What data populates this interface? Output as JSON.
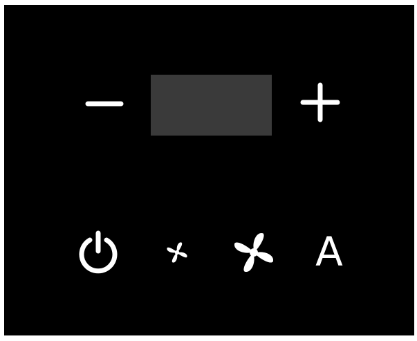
{
  "panel": {
    "background_color": "#000000",
    "foreground_color": "#ffffff",
    "display_color": "#3a3a3a"
  },
  "controls": {
    "minus": {
      "icon": "minus-icon"
    },
    "display": {
      "value": ""
    },
    "plus": {
      "icon": "plus-icon"
    },
    "power": {
      "icon": "power-icon"
    },
    "fan_low": {
      "icon": "fan-icon"
    },
    "fan_high": {
      "icon": "fan-icon"
    },
    "auto": {
      "label": "A"
    }
  }
}
